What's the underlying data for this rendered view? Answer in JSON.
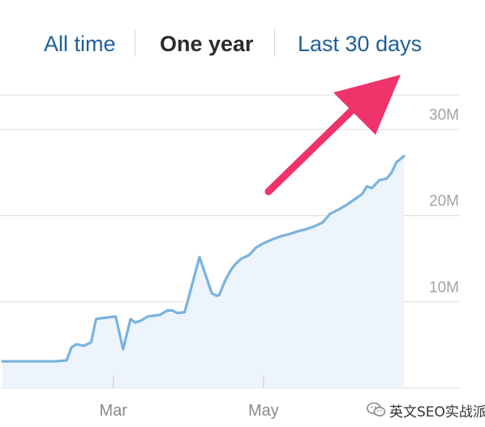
{
  "range_tabs": {
    "all_time": "All time",
    "one_year": "One year",
    "last_30_days": "Last 30 days",
    "active": "One year"
  },
  "watermark": {
    "text": "英文SEO实战派",
    "icon": "wechat-icon"
  },
  "colors": {
    "line": "#7ab3e0",
    "area": "#eef4fc",
    "grid": "#e3e3e3",
    "arrow": "#f0336b",
    "tab_link": "#1f5f9c",
    "tab_active": "#2b2b2b"
  },
  "annotation": {
    "type": "arrow",
    "points_to": "Last 30 days"
  },
  "chart_data": {
    "type": "area",
    "title": "",
    "xlabel": "",
    "ylabel": "",
    "x_tick_labels": [
      "Mar",
      "May"
    ],
    "y_tick_labels": [
      "10M",
      "20M",
      "30M"
    ],
    "y_ticks": [
      10000000,
      20000000,
      30000000
    ],
    "ylim": [
      0,
      34000000
    ],
    "grid": true,
    "series": [
      {
        "name": "",
        "x": [
          "2017-01-15",
          "2017-01-25",
          "2017-02-05",
          "2017-02-10",
          "2017-02-12",
          "2017-02-14",
          "2017-02-17",
          "2017-02-20",
          "2017-02-22",
          "2017-02-24",
          "2017-03-02",
          "2017-03-05",
          "2017-03-08",
          "2017-03-10",
          "2017-03-12",
          "2017-03-15",
          "2017-03-20",
          "2017-03-23",
          "2017-03-25",
          "2017-03-27",
          "2017-03-30",
          "2017-04-05",
          "2017-04-10",
          "2017-04-12",
          "2017-04-13",
          "2017-04-15",
          "2017-04-16",
          "2017-04-18",
          "2017-04-20",
          "2017-04-22",
          "2017-04-25",
          "2017-04-28",
          "2017-05-01",
          "2017-05-05",
          "2017-05-08",
          "2017-05-12",
          "2017-05-15",
          "2017-05-18",
          "2017-05-22",
          "2017-05-25",
          "2017-05-28",
          "2017-06-01",
          "2017-06-04",
          "2017-06-07",
          "2017-06-10",
          "2017-06-12",
          "2017-06-14",
          "2017-06-17",
          "2017-06-20",
          "2017-06-22",
          "2017-06-24",
          "2017-06-27"
        ],
        "values": [
          3100000,
          3100000,
          3100000,
          3200000,
          4700000,
          5100000,
          4900000,
          5300000,
          8000000,
          8100000,
          8300000,
          4500000,
          8000000,
          7600000,
          7800000,
          8300000,
          8500000,
          9000000,
          9000000,
          8700000,
          8800000,
          15200000,
          11000000,
          10700000,
          10800000,
          12200000,
          12800000,
          13800000,
          14500000,
          15000000,
          15400000,
          16300000,
          16800000,
          17300000,
          17600000,
          17900000,
          18200000,
          18400000,
          18800000,
          19200000,
          20200000,
          20800000,
          21300000,
          21900000,
          22500000,
          23400000,
          23200000,
          24100000,
          24300000,
          25000000,
          26200000,
          26900000
        ]
      }
    ]
  }
}
